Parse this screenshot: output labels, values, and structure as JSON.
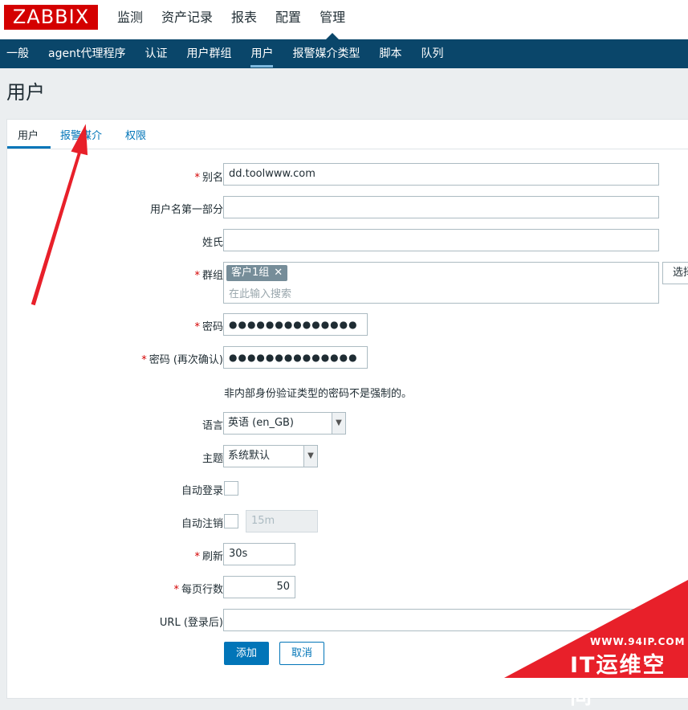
{
  "brand": {
    "logo_text": "ZABBIX",
    "color": "#d40000"
  },
  "main_nav": [
    {
      "label": "监测"
    },
    {
      "label": "资产记录"
    },
    {
      "label": "报表"
    },
    {
      "label": "配置"
    },
    {
      "label": "管理",
      "active": true
    }
  ],
  "sub_nav": [
    {
      "label": "一般"
    },
    {
      "label": "agent代理程序"
    },
    {
      "label": "认证"
    },
    {
      "label": "用户群组"
    },
    {
      "label": "用户",
      "active": true
    },
    {
      "label": "报警媒介类型"
    },
    {
      "label": "脚本"
    },
    {
      "label": "队列"
    }
  ],
  "page": {
    "title": "用户"
  },
  "tabs": [
    {
      "label": "用户",
      "active": true
    },
    {
      "label": "报警媒介"
    },
    {
      "label": "权限"
    }
  ],
  "form": {
    "alias": {
      "label": "别名",
      "required": true,
      "value": "dd.toolwww.com"
    },
    "name": {
      "label": "用户名第一部分",
      "value": ""
    },
    "surname": {
      "label": "姓氏",
      "value": ""
    },
    "groups": {
      "label": "群组",
      "required": true,
      "selected": [
        {
          "label": "客户1组"
        }
      ],
      "placeholder": "在此输入搜索",
      "select_button": "选择"
    },
    "password": {
      "label": "密码",
      "required": true,
      "value": "●●●●●●●●●●●●●●"
    },
    "password_confirm": {
      "label": "密码 (再次确认)",
      "required": true,
      "value": "●●●●●●●●●●●●●●"
    },
    "password_hint": "非内部身份验证类型的密码不是强制的。",
    "language": {
      "label": "语言",
      "value": "英语 (en_GB)"
    },
    "theme": {
      "label": "主题",
      "value": "系统默认"
    },
    "autologin": {
      "label": "自动登录",
      "checked": false
    },
    "autologout": {
      "label": "自动注销",
      "checked": false,
      "value": "15m"
    },
    "refresh": {
      "label": "刷新",
      "required": true,
      "value": "30s"
    },
    "rows_per_page": {
      "label": "每页行数",
      "required": true,
      "value": "50"
    },
    "url": {
      "label": "URL (登录后)",
      "value": ""
    },
    "buttons": {
      "add": "添加",
      "cancel": "取消"
    }
  },
  "watermark": {
    "line1": "WWW.94IP.COM",
    "line2": "IT运维空间",
    "color": "#e8202a"
  }
}
